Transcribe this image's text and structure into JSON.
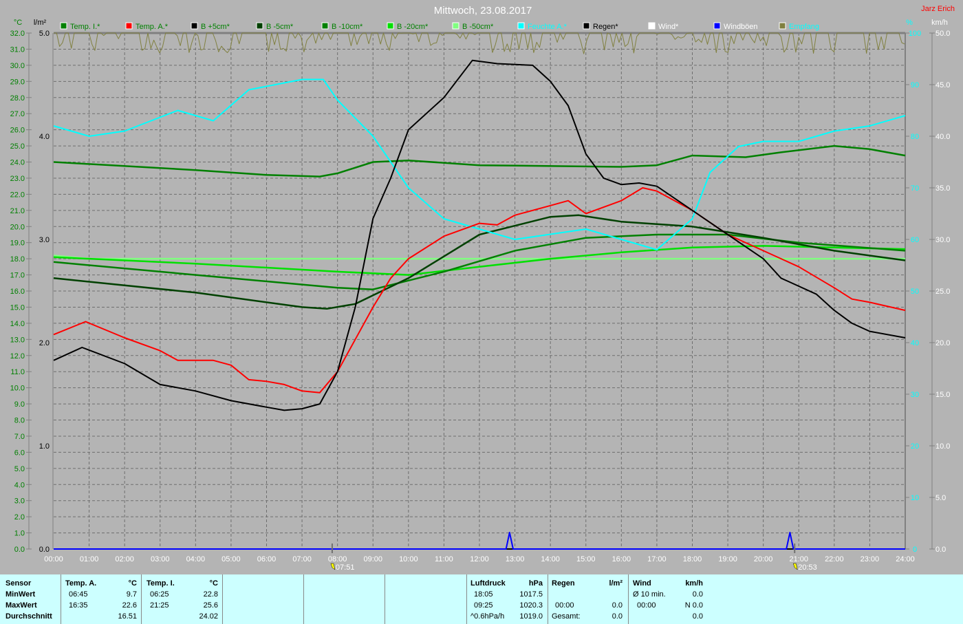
{
  "header": {
    "title": "Mittwoch, 23.08.2017",
    "author": "Jarz Erich"
  },
  "units": {
    "temp": "°C",
    "rain": "l/m²",
    "humidity": "%",
    "wind": "km/h"
  },
  "legend": [
    {
      "label": "Temp. I.*",
      "color": "#008000",
      "text_color": "#008000"
    },
    {
      "label": "Temp. A.*",
      "color": "#ff0000",
      "text_color": "#008000"
    },
    {
      "label": "B +5cm*",
      "color": "#000000",
      "text_color": "#008000"
    },
    {
      "label": "B -5cm*",
      "color": "#004000",
      "text_color": "#008000"
    },
    {
      "label": "B -10cm*",
      "color": "#008000",
      "text_color": "#008000"
    },
    {
      "label": "B -20cm*",
      "color": "#00e000",
      "text_color": "#008000"
    },
    {
      "label": "B -50cm*",
      "color": "#80ff80",
      "text_color": "#008000"
    },
    {
      "label": "Feuchte A.*",
      "color": "#00ffff",
      "text_color": "#00ffff"
    },
    {
      "label": "Regen*",
      "color": "#000000",
      "text_color": "#000000"
    },
    {
      "label": "Wind*",
      "color": "#ffffff",
      "text_color": "#ffffff"
    },
    {
      "label": "Windböen",
      "color": "#0000ff",
      "text_color": "#ffffff"
    },
    {
      "label": "Empfang",
      "color": "#808040",
      "text_color": "#00ffff"
    }
  ],
  "chart_data": {
    "type": "line",
    "title": "Mittwoch, 23.08.2017",
    "xlabel": "",
    "xlim": [
      0,
      24
    ],
    "x_ticks": [
      "00:00",
      "01:00",
      "02:00",
      "03:00",
      "04:00",
      "05:00",
      "06:00",
      "07:00",
      "08:00",
      "09:00",
      "10:00",
      "11:00",
      "12:00",
      "13:00",
      "14:00",
      "15:00",
      "16:00",
      "17:00",
      "18:00",
      "19:00",
      "20:00",
      "21:00",
      "22:00",
      "23:00",
      "24:00"
    ],
    "axes": {
      "temp": {
        "label": "°C",
        "ylim": [
          0,
          32
        ],
        "ticks": [
          "0.0",
          "1.0",
          "2.0",
          "3.0",
          "4.0",
          "5.0",
          "6.0",
          "7.0",
          "8.0",
          "9.0",
          "10.0",
          "11.0",
          "12.0",
          "13.0",
          "14.0",
          "15.0",
          "16.0",
          "17.0",
          "18.0",
          "19.0",
          "20.0",
          "21.0",
          "22.0",
          "23.0",
          "24.0",
          "25.0",
          "26.0",
          "27.0",
          "28.0",
          "29.0",
          "30.0",
          "31.0",
          "32.0"
        ]
      },
      "rain": {
        "label": "l/m²",
        "ylim": [
          0,
          5
        ],
        "ticks": [
          "0.0",
          "1.0",
          "2.0",
          "3.0",
          "4.0",
          "5.0"
        ]
      },
      "humidity": {
        "label": "%",
        "ylim": [
          0,
          100
        ],
        "ticks": [
          "0",
          "10",
          "20",
          "30",
          "40",
          "50",
          "60",
          "70",
          "80",
          "90",
          "100"
        ]
      },
      "wind": {
        "label": "km/h",
        "ylim": [
          0,
          50
        ],
        "ticks": [
          "0.0",
          "5.0",
          "10.0",
          "15.0",
          "20.0",
          "25.0",
          "30.0",
          "35.0",
          "40.0",
          "45.0",
          "50.0"
        ]
      }
    },
    "sunrise": "07:51",
    "sunset": "20:53",
    "series": [
      {
        "name": "Empfang",
        "axis": "humidity",
        "color": "#808040",
        "noise": true,
        "x": [
          0,
          24
        ],
        "y": [
          100,
          100
        ]
      },
      {
        "name": "B -50cm",
        "axis": "temp",
        "color": "#80ff80",
        "x": [
          0,
          1,
          24
        ],
        "y": [
          18.2,
          18.0,
          18.0
        ]
      },
      {
        "name": "B -20cm",
        "axis": "temp",
        "color": "#00e000",
        "x": [
          0,
          4,
          8,
          10,
          12,
          14,
          16,
          18,
          20,
          24
        ],
        "y": [
          18.1,
          17.7,
          17.2,
          17.0,
          17.5,
          18.0,
          18.4,
          18.7,
          18.8,
          18.6
        ]
      },
      {
        "name": "B -10cm",
        "axis": "temp",
        "color": "#008000",
        "x": [
          0,
          4,
          8,
          9,
          11,
          13,
          15,
          17,
          19,
          21,
          24
        ],
        "y": [
          17.8,
          17.0,
          16.2,
          16.1,
          17.2,
          18.5,
          19.3,
          19.5,
          19.5,
          19.0,
          18.5
        ]
      },
      {
        "name": "B -5cm",
        "axis": "temp",
        "color": "#004000",
        "x": [
          0,
          4,
          7,
          7.7,
          8.5,
          10,
          12,
          14,
          14.8,
          16,
          18,
          20,
          22,
          24
        ],
        "y": [
          16.8,
          15.9,
          15.0,
          14.9,
          15.2,
          16.8,
          19.5,
          20.6,
          20.7,
          20.3,
          20.0,
          19.3,
          18.5,
          17.9
        ]
      },
      {
        "name": "Temp. I.",
        "axis": "temp",
        "color": "#008000",
        "x": [
          0,
          4,
          6,
          7.5,
          8,
          9,
          10,
          12,
          16,
          17,
          18,
          19.5,
          20.5,
          22,
          23,
          24
        ],
        "y": [
          24.0,
          23.5,
          23.2,
          23.1,
          23.3,
          24.0,
          24.1,
          23.8,
          23.7,
          23.8,
          24.4,
          24.3,
          24.6,
          25.0,
          24.8,
          24.4
        ]
      },
      {
        "name": "Feuchte A.",
        "axis": "humidity",
        "color": "#00ffff",
        "x": [
          0,
          1,
          2,
          3.5,
          4.5,
          5.5,
          7,
          7.6,
          8,
          9,
          10,
          11,
          12,
          13,
          14,
          15,
          16,
          17,
          18,
          18.5,
          19.3,
          20,
          21,
          22,
          23,
          24
        ],
        "y": [
          82,
          80,
          81,
          85,
          83,
          89,
          91,
          91,
          87,
          80,
          70,
          64,
          62,
          60,
          61,
          62,
          60,
          58,
          64,
          73,
          78,
          79,
          79,
          81,
          82,
          84
        ]
      },
      {
        "name": "Temp. A.",
        "axis": "temp",
        "color": "#ff0000",
        "x": [
          0,
          0.9,
          2,
          3,
          3.5,
          4.5,
          5,
          5.5,
          6,
          6.5,
          7,
          7.5,
          8,
          8.5,
          9,
          9.5,
          10,
          11,
          12,
          12.5,
          13,
          14,
          14.5,
          15,
          16,
          16.6,
          17,
          18,
          19,
          20,
          21,
          22,
          22.5,
          23,
          24
        ],
        "y": [
          13.3,
          14.1,
          13.1,
          12.3,
          11.7,
          11.7,
          11.4,
          10.5,
          10.4,
          10.2,
          9.8,
          9.7,
          11.0,
          13.0,
          15.0,
          16.8,
          18.0,
          19.4,
          20.2,
          20.1,
          20.7,
          21.3,
          21.6,
          20.8,
          21.6,
          22.4,
          22.2,
          21.0,
          19.5,
          18.5,
          17.5,
          16.2,
          15.5,
          15.3,
          14.8
        ]
      },
      {
        "name": "B +5cm",
        "axis": "temp",
        "color": "#000000",
        "x": [
          0,
          0.8,
          2,
          3,
          4,
          5,
          6,
          6.5,
          7,
          7.5,
          8,
          8.5,
          9,
          9.5,
          10,
          11,
          11.8,
          12.5,
          13.5,
          14,
          14.5,
          15,
          15.5,
          16,
          16.5,
          17,
          18,
          19,
          20,
          20.5,
          21.5,
          22,
          22.5,
          23,
          24
        ],
        "y": [
          11.7,
          12.5,
          11.5,
          10.2,
          9.8,
          9.2,
          8.8,
          8.6,
          8.7,
          9.0,
          11.0,
          15.0,
          20.5,
          23.0,
          26.0,
          28.0,
          30.3,
          30.1,
          30.0,
          29.0,
          27.5,
          24.5,
          23.0,
          22.6,
          22.7,
          22.5,
          21.0,
          19.5,
          18.0,
          16.8,
          15.8,
          14.8,
          14.0,
          13.5,
          13.1
        ]
      },
      {
        "name": "Regen",
        "axis": "rain",
        "color": "#000000",
        "x": [
          0,
          24
        ],
        "y": [
          0,
          0
        ]
      },
      {
        "name": "Windböen",
        "axis": "wind",
        "color": "#0000ff",
        "x": [
          0,
          12.75,
          12.85,
          12.95,
          20.65,
          20.75,
          20.85,
          24
        ],
        "y": [
          0,
          0,
          1.6,
          0,
          0,
          1.6,
          0,
          0
        ]
      }
    ]
  },
  "stats": {
    "sensor_header": "Sensor",
    "min_label": "MinWert",
    "max_label": "MaxWert",
    "avg_label": "Durchschnitt",
    "temp_a": {
      "title": "Temp. A.",
      "unit": "°C",
      "min_time": "06:45",
      "min": "9.7",
      "max_time": "16:35",
      "max": "22.6",
      "avg": "16.51"
    },
    "temp_i": {
      "title": "Temp. I.",
      "unit": "°C",
      "min_time": "06:25",
      "min": "22.8",
      "max_time": "21:25",
      "max": "25.6",
      "avg": "24.02"
    },
    "pressure": {
      "title": "Luftdruck",
      "unit": "hPa",
      "min_time": "18:05",
      "min": "1017.5",
      "max_time": "09:25",
      "max": "1020.3",
      "trend": "^0.6hPa/h",
      "current": "1019.0"
    },
    "rain": {
      "title": "Regen",
      "unit": "l/m²",
      "time": "00:00",
      "value": "0.0",
      "total_label": "Gesamt:",
      "total": "0.0"
    },
    "wind": {
      "title": "Wind",
      "unit": "km/h",
      "avg_label": "Ø 10 min.",
      "avg": "0.0",
      "time": "00:00",
      "max": "N 0.0",
      "current": "0.0"
    }
  }
}
